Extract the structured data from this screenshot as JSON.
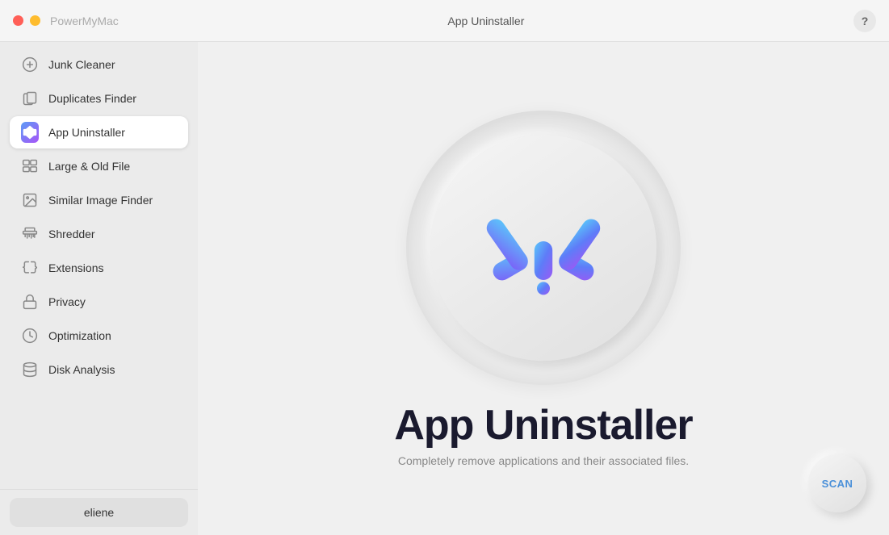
{
  "titlebar": {
    "app_name": "PowerMyMac",
    "center_title": "App Uninstaller",
    "help_label": "?"
  },
  "sidebar": {
    "items": [
      {
        "id": "junk-cleaner",
        "label": "Junk Cleaner",
        "icon": "junk",
        "active": false
      },
      {
        "id": "duplicates-finder",
        "label": "Duplicates Finder",
        "icon": "duplicates",
        "active": false
      },
      {
        "id": "app-uninstaller",
        "label": "App Uninstaller",
        "icon": "app-uninstaller",
        "active": true
      },
      {
        "id": "large-old-file",
        "label": "Large & Old File",
        "icon": "large-file",
        "active": false
      },
      {
        "id": "similar-image-finder",
        "label": "Similar Image Finder",
        "icon": "similar-image",
        "active": false
      },
      {
        "id": "shredder",
        "label": "Shredder",
        "icon": "shredder",
        "active": false
      },
      {
        "id": "extensions",
        "label": "Extensions",
        "icon": "extensions",
        "active": false
      },
      {
        "id": "privacy",
        "label": "Privacy",
        "icon": "privacy",
        "active": false
      },
      {
        "id": "optimization",
        "label": "Optimization",
        "icon": "optimization",
        "active": false
      },
      {
        "id": "disk-analysis",
        "label": "Disk Analysis",
        "icon": "disk-analysis",
        "active": false
      }
    ],
    "user": {
      "label": "eliene"
    }
  },
  "main": {
    "hero_title": "App Uninstaller",
    "hero_subtitle": "Completely remove applications and their associated files.",
    "scan_label": "SCAN"
  },
  "colors": {
    "red": "#ff5f57",
    "yellow": "#febc2e",
    "green": "#28c840",
    "active_bg": "white",
    "scan_color": "#4a90d9"
  }
}
